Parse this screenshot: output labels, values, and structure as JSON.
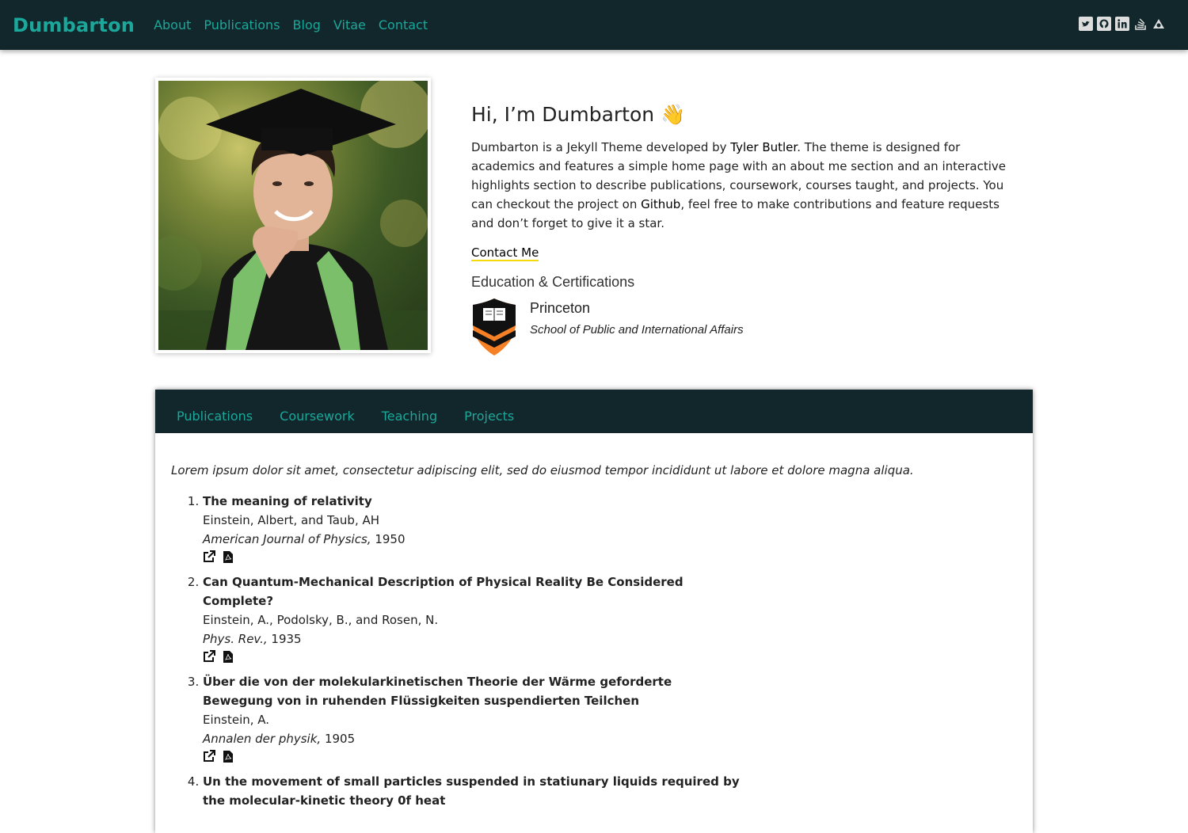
{
  "brand": "Dumbarton",
  "nav": [
    "About",
    "Publications",
    "Blog",
    "Vitae",
    "Contact"
  ],
  "social_icons": [
    "twitter-icon",
    "github-icon",
    "linkedin-icon",
    "stackoverflow-icon",
    "scholar-icon"
  ],
  "hero": {
    "greeting": "Hi, I’m Dumbarton 👋",
    "bio_part1": "Dumbarton is a Jekyll Theme developed by ",
    "bio_link1": "Tyler Butler",
    "bio_part2": ". The theme is designed for academics and features a simple home page with an about me section and an interactive highlights section to describe publications, coursework, courses taught, and projects. You can checkout the project on ",
    "bio_link2": "Github",
    "bio_part3": ", feel free to make contributions and feature requests and don’t forget to give it a star.",
    "contact_label": "Contact Me",
    "education_title": "Education & Certifications",
    "education": {
      "name": "Princeton",
      "school": "School of Public and International Affairs"
    }
  },
  "tabs": [
    "Publications",
    "Coursework",
    "Teaching",
    "Projects"
  ],
  "intro": "Lorem ipsum dolor sit amet, consectetur adipiscing elit, sed do eiusmod tempor incididunt ut labore et dolore magna aliqua.",
  "publications": [
    {
      "title": "The meaning of relativity",
      "authors": "Einstein, Albert, and Taub, AH",
      "journal": "American Journal of Physics,",
      "year": "1950"
    },
    {
      "title": "Can Quantum-Mechanical Description of Physical Reality Be Considered Complete?",
      "authors": "Einstein, A., Podolsky, B., and Rosen, N.",
      "journal": "Phys. Rev.,",
      "year": "1935"
    },
    {
      "title": "Über die von der molekularkinetischen Theorie der Wärme geforderte Bewegung von in ruhenden Flüssigkeiten suspendierten Teilchen",
      "authors": "Einstein, A.",
      "journal": "Annalen der physik,",
      "year": "1905"
    },
    {
      "title": "Un the movement of small particles suspended in statiunary liquids required by the molecular-kinetic theory 0f heat",
      "authors": "",
      "journal": "",
      "year": ""
    }
  ],
  "colors": {
    "navbar": "#11272c",
    "accent": "#1ba79a",
    "underline": "#f5d90a",
    "princeton_orange": "#f58025"
  }
}
